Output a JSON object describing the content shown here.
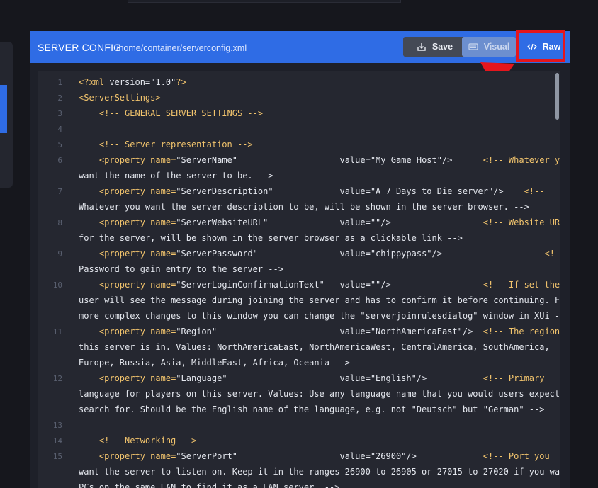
{
  "header": {
    "title": "SERVER CONFIG",
    "path": "/home/container/serverconfig.xml",
    "save_label": "Save",
    "visual_label": "Visual",
    "raw_label": "Raw"
  },
  "colors": {
    "header_bg": "#2f6ce5",
    "highlight": "#e5161d",
    "syntax": "#f2c46d"
  },
  "editor": {
    "line_numbers": [
      "1",
      "2",
      "3",
      "4",
      "5",
      "6",
      "7",
      "8",
      "9",
      "10",
      "11",
      "12",
      "13",
      "14",
      "15"
    ],
    "lines": [
      "<?xml version=\"1.0\"?>",
      "<ServerSettings>",
      "    <!-- GENERAL SERVER SETTINGS -->",
      "",
      "    <!-- Server representation -->",
      "    <property name=\"ServerName\"                    value=\"My Game Host\"/>      <!-- Whatever you",
      "want the name of the server to be. -->",
      "    <property name=\"ServerDescription\"             value=\"A 7 Days to Die server\"/>    <!--",
      "Whatever you want the server description to be, will be shown in the server browser. -->",
      "    <property name=\"ServerWebsiteURL\"              value=\"\"/>                  <!-- Website URL",
      "for the server, will be shown in the server browser as a clickable link -->",
      "    <property name=\"ServerPassword\"                value=\"chippypass\"/>                    <!--",
      "Password to gain entry to the server -->",
      "    <property name=\"ServerLoginConfirmationText\"   value=\"\"/>                  <!-- If set the",
      "user will see the message during joining the server and has to confirm it before continuing. For",
      "more complex changes to this window you can change the \"serverjoinrulesdialog\" window in XUi -->",
      "    <property name=\"Region\"                        value=\"NorthAmericaEast\"/>  <!-- The region",
      "this server is in. Values: NorthAmericaEast, NorthAmericaWest, CentralAmerica, SouthAmerica,",
      "Europe, Russia, Asia, MiddleEast, Africa, Oceania -->",
      "    <property name=\"Language\"                      value=\"English\"/>           <!-- Primary",
      "language for players on this server. Values: Use any language name that you would users expect to",
      "search for. Should be the English name of the language, e.g. not \"Deutsch\" but \"German\" -->",
      "",
      "    <!-- Networking -->",
      "    <property name=\"ServerPort\"                    value=\"26900\"/>             <!-- Port you",
      "want the server to listen on. Keep it in the ranges 26900 to 26905 or 27015 to 27020 if you want",
      "PCs on the same LAN to find it as a LAN server. -->"
    ]
  }
}
